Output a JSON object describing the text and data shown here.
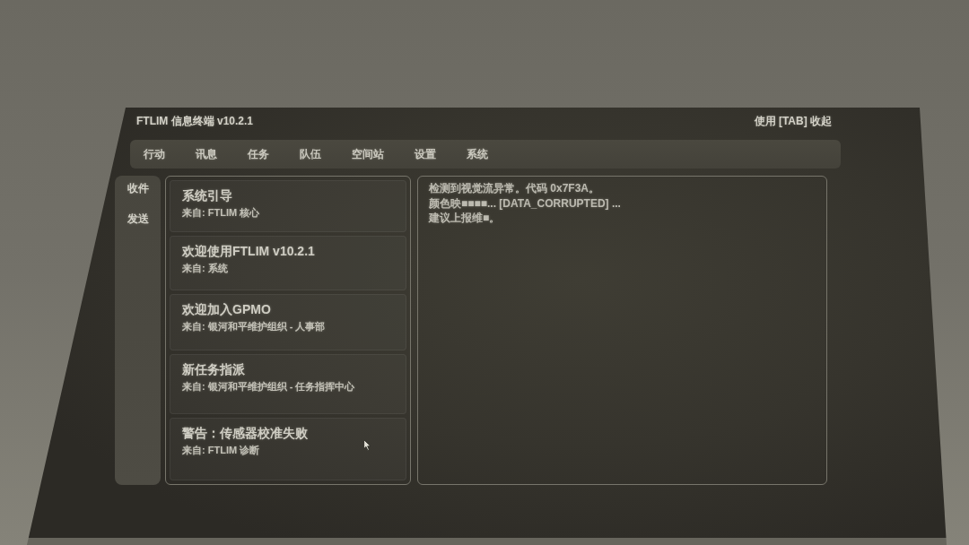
{
  "window": {
    "title": "FTLIM 信息终端 v10.2.1",
    "hint": "使用 [TAB] 收起"
  },
  "tabs": [
    {
      "label": "行动"
    },
    {
      "label": "讯息"
    },
    {
      "label": "任务"
    },
    {
      "label": "队伍"
    },
    {
      "label": "空间站"
    },
    {
      "label": "设置"
    },
    {
      "label": "系统"
    }
  ],
  "sidebar": {
    "items": [
      {
        "label": "收件"
      },
      {
        "label": "发送"
      }
    ]
  },
  "messages": [
    {
      "title": "系统引导",
      "sender": "来自: FTLIM 核心"
    },
    {
      "title": "欢迎使用FTLIM v10.2.1",
      "sender": "来自: 系统"
    },
    {
      "title": "欢迎加入GPMO",
      "sender": "来自: 银河和平维护组织 - 人事部"
    },
    {
      "title": "新任务指派",
      "sender": "来自: 银河和平维护组织 - 任务指挥中心"
    },
    {
      "title": "警告：传感器校准失败",
      "sender": "来自: FTLIM 诊断"
    }
  ],
  "detail": {
    "lines": [
      "检测到视觉流异常。代码 0x7F3A。",
      "颜色映■■■■... [DATA_CORRUPTED] ...",
      "建议上报维■。"
    ]
  }
}
